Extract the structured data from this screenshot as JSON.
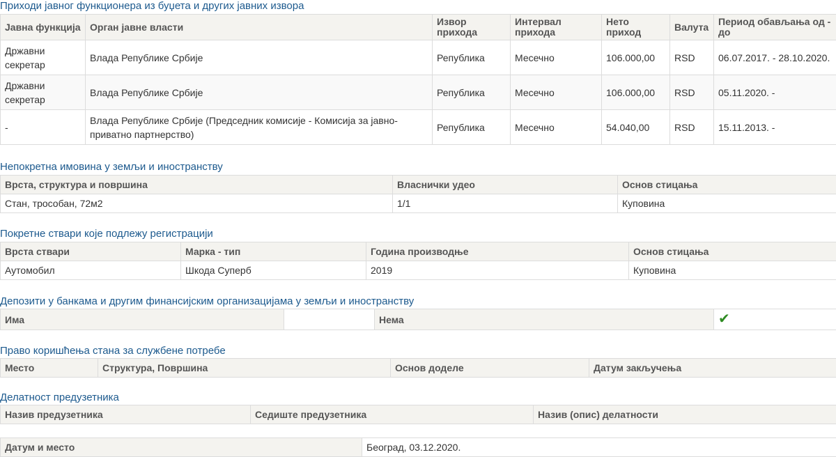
{
  "income": {
    "title": "Приходи јавног функционера из буџета и других јавних извора",
    "headers": [
      "Јавна функција",
      "Орган јавне власти",
      "Извор прихода",
      "Интервал прихода",
      "Нето приход",
      "Валута",
      "Период обављања од - до"
    ],
    "rows": [
      [
        "Државни секретар",
        "Влада Републике Србије",
        "Република",
        "Месечно",
        "106.000,00",
        "RSD",
        "06.07.2017. - 28.10.2020."
      ],
      [
        "Државни секретар",
        "Влада Републике Србије",
        "Република",
        "Месечно",
        "106.000,00",
        "RSD",
        "05.11.2020. -"
      ],
      [
        "-",
        "Влада Републике Србије (Председник комисије - Комисија за јавно-приватно партнерство)",
        "Република",
        "Месечно",
        "54.040,00",
        "RSD",
        "15.11.2013. -"
      ]
    ]
  },
  "real_estate": {
    "title": "Непокретна имовина у земљи и иностранству",
    "headers": [
      "Врста, структура и површина",
      "Власнички удео",
      "Основ стицања"
    ],
    "rows": [
      [
        "Стан, трособан, 72м2",
        "1/1",
        "Куповина"
      ]
    ]
  },
  "vehicles": {
    "title": "Покретне ствари које подлежу регистрацији",
    "headers": [
      "Врста ствари",
      "Марка - тип",
      "Година производње",
      "Основ стицања"
    ],
    "rows": [
      [
        "Аутомобил",
        "Шкода Суперб",
        "2019",
        "Куповина"
      ]
    ]
  },
  "deposits": {
    "title": "Депозити у банкама и другим финансијским организацијама у земљи и иностранству",
    "has_label": "Има",
    "none_label": "Нема",
    "selected": "none",
    "check_icon": "checkmark-icon",
    "check_glyph": "✔"
  },
  "housing": {
    "title": "Право коришћења стана за службене потребе",
    "headers": [
      "Место",
      "Структура, Површина",
      "Основ доделе",
      "Датум закључења"
    ]
  },
  "entrepreneur": {
    "title": "Делатност предузетника",
    "headers": [
      "Назив предузетника",
      "Седиште предузетника",
      "Назив (опис) делатности"
    ]
  },
  "footer": {
    "label": "Датум и место",
    "value": "Београд, 03.12.2020."
  }
}
